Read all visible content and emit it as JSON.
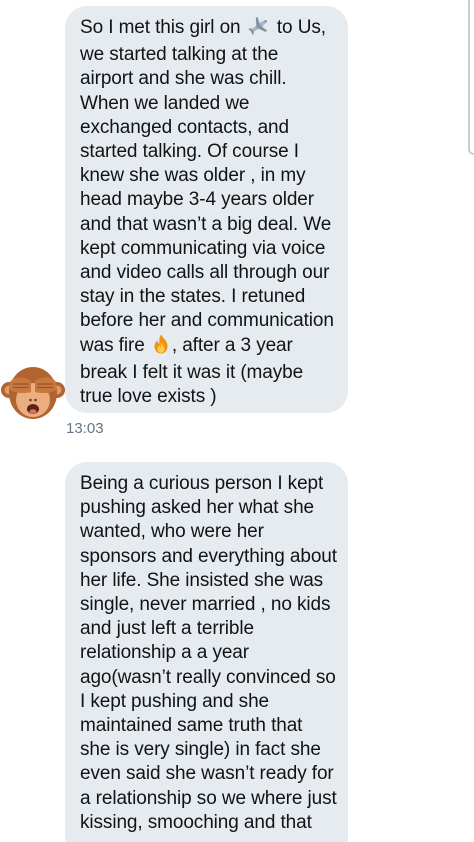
{
  "conversation": {
    "messages": [
      {
        "lines": [
          {
            "before": "So I met this girl on ",
            "emoji": "airplane-icon",
            "after": " to Us,"
          },
          {
            "text": "we started talking at the"
          },
          {
            "text": "airport and she was chill."
          },
          {
            "text": "When we landed we"
          },
          {
            "text": "exchanged contacts, and"
          },
          {
            "text": "started talking. Of course I"
          },
          {
            "text": "knew she was older , in my"
          },
          {
            "text": "head maybe 3-4 years older"
          },
          {
            "text": "and that wasn’t a big deal. We"
          },
          {
            "text": "kept communicating via voice"
          },
          {
            "text": "and video calls all through our"
          },
          {
            "text": "stay in the states. I retuned"
          },
          {
            "text": "before her and communication"
          },
          {
            "before": "was fire ",
            "emoji": "fire-icon",
            "after": ", after a 3 year"
          },
          {
            "text": "break I felt it was it (maybe"
          },
          {
            "text": "true love exists )"
          }
        ],
        "timestamp": "13:03",
        "sender_avatar": "see-no-evil-monkey-icon"
      },
      {
        "lines": [
          {
            "text": "Being a curious person I kept"
          },
          {
            "text": "pushing asked her what she"
          },
          {
            "text": "wanted, who were her"
          },
          {
            "text": "sponsors and everything about"
          },
          {
            "text": "her life. She insisted she was"
          },
          {
            "text": "single, never married , no kids"
          },
          {
            "text": "and just left a terrible"
          },
          {
            "text": "relationship a a year"
          },
          {
            "text": "ago(wasn’t really convinced so"
          },
          {
            "text": "I kept pushing and she"
          },
          {
            "text": "maintained same truth that"
          },
          {
            "text": "she is very single) in fact she"
          },
          {
            "text": "even said she wasn’t ready for"
          },
          {
            "text": "a relationship so we where just"
          },
          {
            "text": "kissing, smooching and that"
          }
        ]
      }
    ]
  },
  "colors": {
    "bubble_background": "#e6ebef",
    "text": "#111417",
    "timestamp": "#657786"
  }
}
